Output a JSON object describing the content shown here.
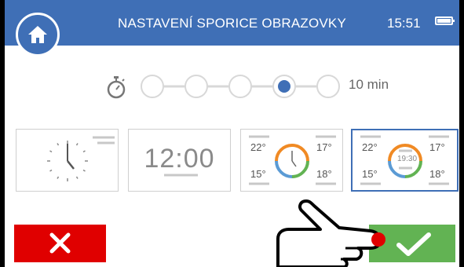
{
  "header": {
    "title": "NASTAVENÍ SPORICE OBRAZOVKY",
    "time": "15:51",
    "battery_icon": "battery-full-icon",
    "home_icon": "home-icon",
    "background_color": "#3f6fb6"
  },
  "timeout_slider": {
    "icon": "stopwatch-icon",
    "steps": 5,
    "selected_step": 4,
    "value_label": "10 min"
  },
  "screensaver_options": [
    {
      "name": "analog-clock",
      "selected": false
    },
    {
      "name": "digital-clock",
      "time": "12:00",
      "selected": false
    },
    {
      "name": "analog-clock-with-temperatures",
      "temps": [
        "22°",
        "17°",
        "15°",
        "18°"
      ],
      "selected": false
    },
    {
      "name": "digital-clock-with-temperatures",
      "time": "19:30",
      "temps": [
        "22°",
        "17°",
        "15°",
        "18°"
      ],
      "selected": true
    }
  ],
  "buttons": {
    "cancel_icon": "close-icon",
    "cancel_color": "#e00000",
    "confirm_icon": "checkmark-icon",
    "confirm_color": "#62b353"
  },
  "overlay": {
    "icon": "pointing-hand-icon",
    "tap_marker_color": "#e00000"
  }
}
